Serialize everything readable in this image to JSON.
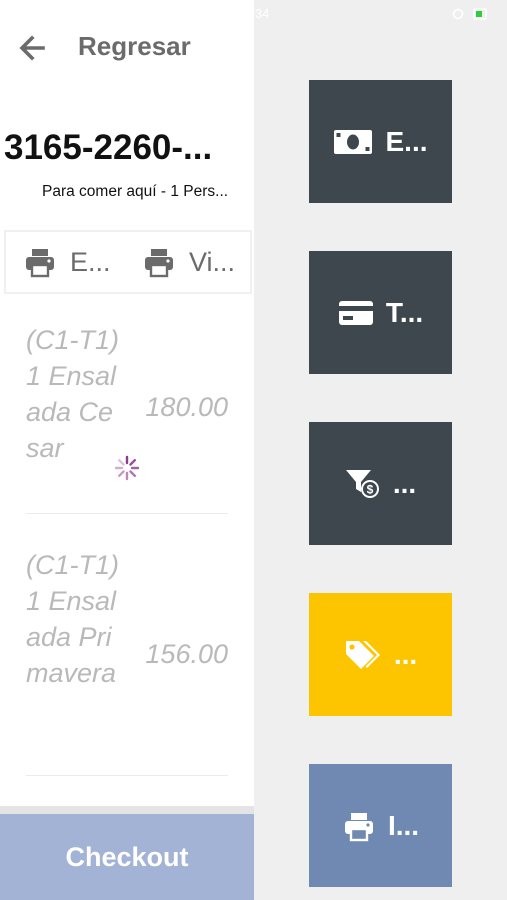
{
  "status_bar": {
    "time": "34"
  },
  "header": {
    "back_label": "Regresar"
  },
  "order": {
    "number": "3165-2260-...",
    "subtitle": "Para comer aquí - 1 Pers..."
  },
  "actions": [
    {
      "icon": "printer-icon",
      "label": "E..."
    },
    {
      "icon": "printer-icon",
      "label": "Vi..."
    }
  ],
  "items": [
    {
      "description": "(C1-T1) 1 Ensalada Cesar",
      "price": "180.00"
    },
    {
      "description": "(C1-T1) 1 Ensalada Primavera",
      "price": "156.00"
    }
  ],
  "checkout_label": "Checkout",
  "tiles": [
    {
      "icon": "cash-icon",
      "label": "E...",
      "color": "#3d474d"
    },
    {
      "icon": "credit-card-icon",
      "label": "T...",
      "color": "#3d474d"
    },
    {
      "icon": "discount-filter-icon",
      "label": "...",
      "color": "#3d474d"
    },
    {
      "icon": "tags-icon",
      "label": "...",
      "color": "#fdc400"
    },
    {
      "icon": "printer-icon",
      "label": "I...",
      "color": "#6f89b3"
    }
  ]
}
